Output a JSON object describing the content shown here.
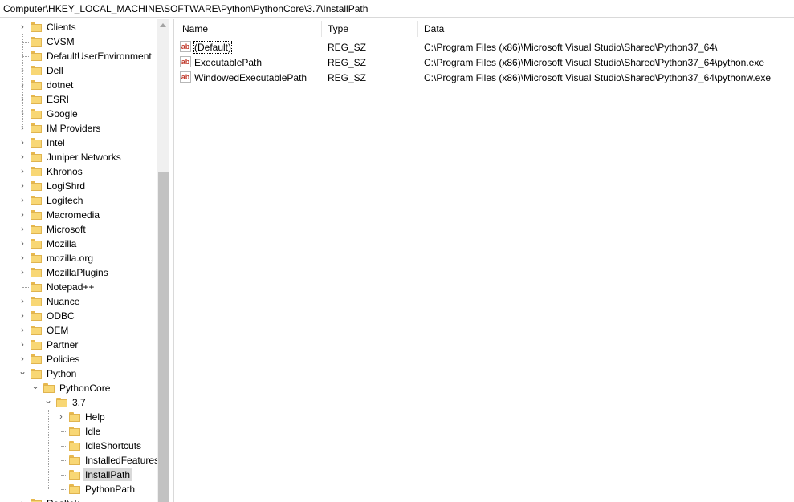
{
  "address": "Computer\\HKEY_LOCAL_MACHINE\\SOFTWARE\\Python\\PythonCore\\3.7\\InstallPath",
  "tree": [
    {
      "label": "Clients",
      "level": 0,
      "expander": "closed"
    },
    {
      "label": "CVSM",
      "level": 0,
      "expander": "none"
    },
    {
      "label": "DefaultUserEnvironment",
      "level": 0,
      "expander": "none"
    },
    {
      "label": "Dell",
      "level": 0,
      "expander": "closed"
    },
    {
      "label": "dotnet",
      "level": 0,
      "expander": "closed"
    },
    {
      "label": "ESRI",
      "level": 0,
      "expander": "closed"
    },
    {
      "label": "Google",
      "level": 0,
      "expander": "closed"
    },
    {
      "label": "IM Providers",
      "level": 0,
      "expander": "closed"
    },
    {
      "label": "Intel",
      "level": 0,
      "expander": "closed"
    },
    {
      "label": "Juniper Networks",
      "level": 0,
      "expander": "closed"
    },
    {
      "label": "Khronos",
      "level": 0,
      "expander": "closed"
    },
    {
      "label": "LogiShrd",
      "level": 0,
      "expander": "closed"
    },
    {
      "label": "Logitech",
      "level": 0,
      "expander": "closed"
    },
    {
      "label": "Macromedia",
      "level": 0,
      "expander": "closed"
    },
    {
      "label": "Microsoft",
      "level": 0,
      "expander": "closed"
    },
    {
      "label": "Mozilla",
      "level": 0,
      "expander": "closed"
    },
    {
      "label": "mozilla.org",
      "level": 0,
      "expander": "closed"
    },
    {
      "label": "MozillaPlugins",
      "level": 0,
      "expander": "closed"
    },
    {
      "label": "Notepad++",
      "level": 0,
      "expander": "none"
    },
    {
      "label": "Nuance",
      "level": 0,
      "expander": "closed"
    },
    {
      "label": "ODBC",
      "level": 0,
      "expander": "closed"
    },
    {
      "label": "OEM",
      "level": 0,
      "expander": "closed"
    },
    {
      "label": "Partner",
      "level": 0,
      "expander": "closed"
    },
    {
      "label": "Policies",
      "level": 0,
      "expander": "closed"
    },
    {
      "label": "Python",
      "level": 0,
      "expander": "open"
    },
    {
      "label": "PythonCore",
      "level": 1,
      "expander": "open"
    },
    {
      "label": "3.7",
      "level": 2,
      "expander": "open"
    },
    {
      "label": "Help",
      "level": 3,
      "expander": "closed"
    },
    {
      "label": "Idle",
      "level": 3,
      "expander": "none"
    },
    {
      "label": "IdleShortcuts",
      "level": 3,
      "expander": "none"
    },
    {
      "label": "InstalledFeatures",
      "level": 3,
      "expander": "none"
    },
    {
      "label": "InstallPath",
      "level": 3,
      "expander": "none",
      "selected": true
    },
    {
      "label": "PythonPath",
      "level": 3,
      "expander": "none"
    },
    {
      "label": "Realtek",
      "level": 0,
      "expander": "closed"
    }
  ],
  "columns": {
    "name": "Name",
    "type": "Type",
    "data": "Data"
  },
  "values": [
    {
      "name": "(Default)",
      "type": "REG_SZ",
      "data": "C:\\Program Files (x86)\\Microsoft Visual Studio\\Shared\\Python37_64\\",
      "focused": true
    },
    {
      "name": "ExecutablePath",
      "type": "REG_SZ",
      "data": "C:\\Program Files (x86)\\Microsoft Visual Studio\\Shared\\Python37_64\\python.exe"
    },
    {
      "name": "WindowedExecutablePath",
      "type": "REG_SZ",
      "data": "C:\\Program Files (x86)\\Microsoft Visual Studio\\Shared\\Python37_64\\pythonw.exe"
    }
  ],
  "icons": {
    "value_icon": "string-value-icon",
    "folder_icon": "folder-icon"
  }
}
